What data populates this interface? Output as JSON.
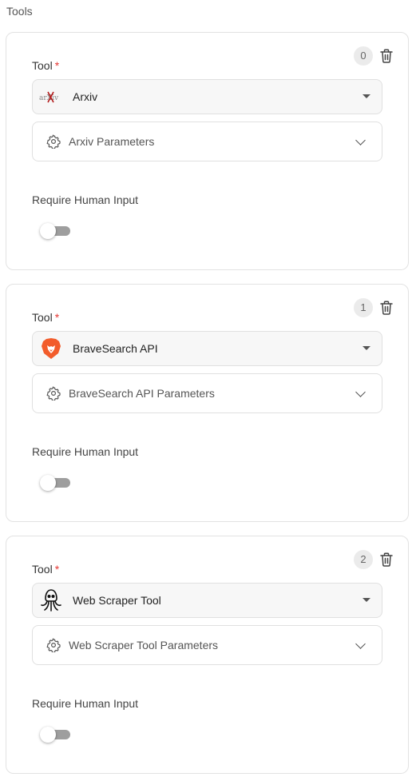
{
  "section_title": "Tools",
  "colors": {
    "required": "#e53935",
    "toggle_off_track": "#9e9e9e",
    "brave_orange": "#f25c2b",
    "arxiv_red": "#b31b1b"
  },
  "tools": [
    {
      "index": "0",
      "field_label": "Tool",
      "required_mark": "*",
      "selected": "Arxiv",
      "logo": "arxiv-logo",
      "logo_text": "arXiv",
      "params_label": "Arxiv Parameters",
      "human_input_label": "Require Human Input",
      "human_input_enabled": false
    },
    {
      "index": "1",
      "field_label": "Tool",
      "required_mark": "*",
      "selected": "BraveSearch API",
      "logo": "brave-lion-logo",
      "params_label": "BraveSearch API Parameters",
      "human_input_label": "Require Human Input",
      "human_input_enabled": false
    },
    {
      "index": "2",
      "field_label": "Tool",
      "required_mark": "*",
      "selected": "Web Scraper Tool",
      "logo": "octopus-logo",
      "params_label": "Web Scraper Tool Parameters",
      "human_input_label": "Require Human Input",
      "human_input_enabled": false
    }
  ]
}
